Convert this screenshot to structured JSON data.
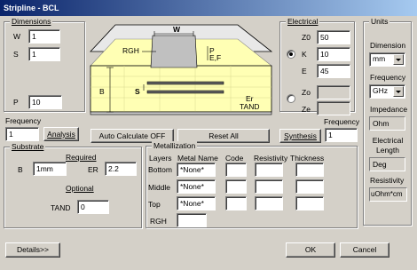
{
  "window": {
    "title": "Stripline - BCL"
  },
  "dimensions": {
    "legend": "Dimensions",
    "w_label": "W",
    "w_value": "1",
    "s_label": "S",
    "s_value": "1",
    "p_label": "P",
    "p_value": "10"
  },
  "diagram": {
    "w_label": "W",
    "p_label": "P",
    "ef_label": "E,F",
    "rgh_label": "RGH",
    "b_label": "B",
    "s_label": "S",
    "er_label": "Er",
    "tand_label": "TAND"
  },
  "electrical": {
    "legend": "Electrical",
    "z0_label": "Z0",
    "z0_value": "50",
    "k_label": "K",
    "k_value": "10",
    "e_label": "E",
    "e_value": "45",
    "zo_label": "Zo",
    "ze_label": "Ze"
  },
  "units": {
    "legend": "Units",
    "dimension_label": "Dimension",
    "dimension_value": "mm",
    "frequency_label": "Frequency",
    "frequency_value": "GHz",
    "impedance_label": "Impedance",
    "impedance_value": "Ohm",
    "electrical_length_label": "Electrical Length",
    "electrical_length_value": "Deg",
    "resistivity_label": "Resistivity",
    "resistivity_value": "uOhm*cm"
  },
  "controls": {
    "frequency_label_left": "Frequency",
    "frequency_left_value": "1",
    "analysis_label": "Analysis",
    "auto_calc_label": "Auto Calculate OFF",
    "reset_label": "Reset  All",
    "synthesis_label": "Synthesis",
    "frequency_label_right": "Frequency",
    "frequency_right_value": "1"
  },
  "substrate": {
    "legend": "Substrate",
    "required_label": "Required",
    "b_label": "B",
    "b_value": "1mm",
    "er_label": "ER",
    "er_value": "2.2",
    "optional_label": "Optional",
    "tand_label": "TAND",
    "tand_value": "0"
  },
  "metallization": {
    "legend": "Metallization",
    "headers": {
      "layers": "Layers",
      "metal_name": "Metal Name",
      "code": "Code",
      "resistivity": "Resistivity",
      "thickness": "Thickness"
    },
    "rows": [
      {
        "layer": "Bottom",
        "metal": "*None*"
      },
      {
        "layer": "Middle",
        "metal": "*None*"
      },
      {
        "layer": "Top",
        "metal": "*None*"
      }
    ],
    "rgh_label": "RGH"
  },
  "footer": {
    "details_label": "Details>>",
    "ok_label": "OK",
    "cancel_label": "Cancel"
  }
}
